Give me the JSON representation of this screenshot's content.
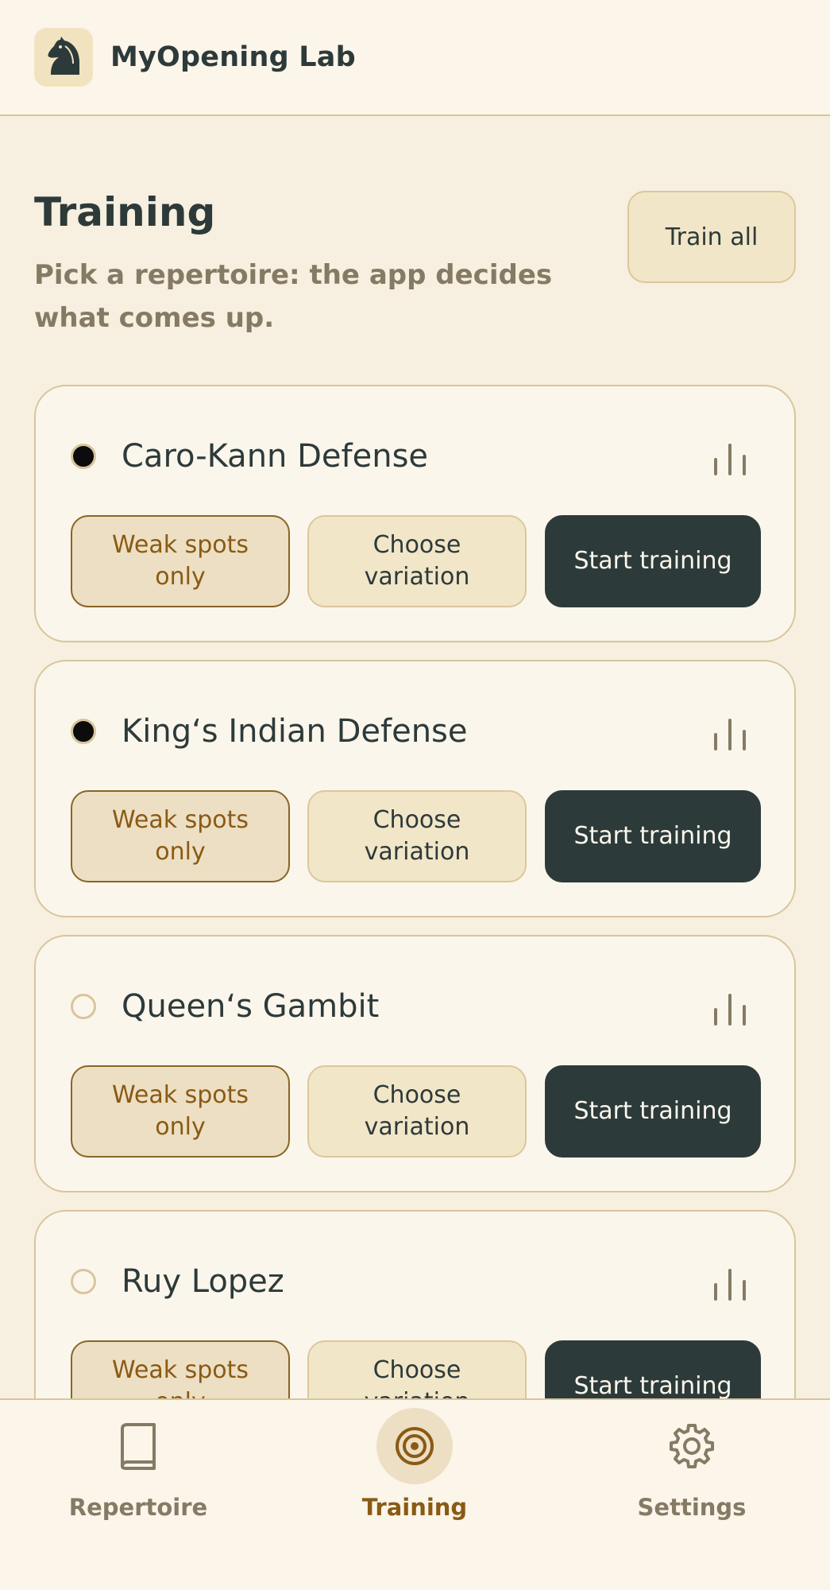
{
  "app": {
    "title": "MyOpening Lab",
    "logo_icon": "knight-icon"
  },
  "page": {
    "title": "Training",
    "subtitle": "Pick a repertoire: the app decides what comes up.",
    "train_all_label": "Train all"
  },
  "buttons": {
    "weak_spots": "Weak spots only",
    "choose_variation": "Choose variation",
    "start_training": "Start training"
  },
  "repertoires": [
    {
      "name": "Caro-Kann Defense",
      "selected": true
    },
    {
      "name": "King‘s Indian Defense",
      "selected": true
    },
    {
      "name": "Queen‘s Gambit",
      "selected": false
    },
    {
      "name": "Ruy Lopez",
      "selected": false
    }
  ],
  "nav": [
    {
      "label": "Repertoire",
      "icon": "book-icon",
      "active": false
    },
    {
      "label": "Training",
      "icon": "target-icon",
      "active": true
    },
    {
      "label": "Settings",
      "icon": "gear-icon",
      "active": false
    }
  ],
  "colors": {
    "background": "#f7efdf",
    "primary_dark": "#2d3a3a",
    "accent_brown": "#8a5a14",
    "border": "#d8c59c"
  }
}
